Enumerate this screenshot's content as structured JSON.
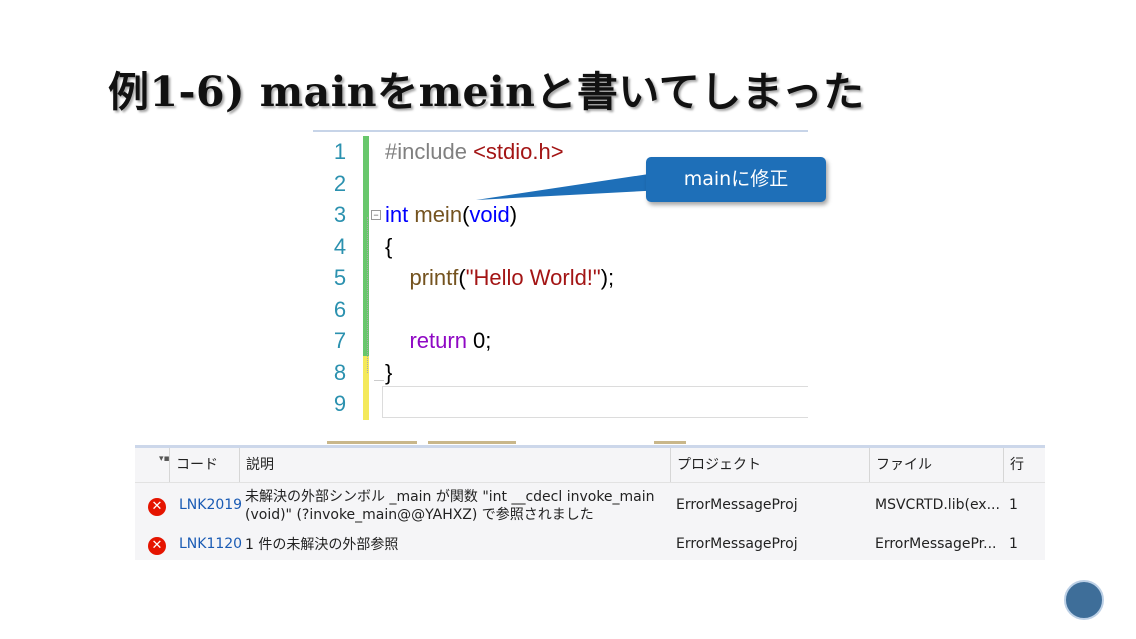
{
  "slide": {
    "title": "例1-6) mainをmeinと書いてしまった"
  },
  "editor": {
    "line_numbers": [
      "1",
      "2",
      "3",
      "4",
      "5",
      "6",
      "7",
      "8",
      "9"
    ],
    "lines": [
      {
        "segments": [
          {
            "t": "#include ",
            "c": "pre"
          },
          {
            "t": "<stdio.h>",
            "c": "str"
          }
        ]
      },
      {
        "segments": []
      },
      {
        "segments": [
          {
            "t": "int",
            "c": "kw"
          },
          {
            "t": " ",
            "c": ""
          },
          {
            "t": "mein",
            "c": "fn"
          },
          {
            "t": "(",
            "c": ""
          },
          {
            "t": "void",
            "c": "kw"
          },
          {
            "t": ")",
            "c": ""
          }
        ]
      },
      {
        "segments": [
          {
            "t": "{",
            "c": ""
          }
        ]
      },
      {
        "segments": [
          {
            "t": "    ",
            "c": ""
          },
          {
            "t": "printf",
            "c": "fn"
          },
          {
            "t": "(",
            "c": ""
          },
          {
            "t": "\"Hello World!\"",
            "c": "str"
          },
          {
            "t": ");",
            "c": ""
          }
        ]
      },
      {
        "segments": []
      },
      {
        "segments": [
          {
            "t": "    ",
            "c": ""
          },
          {
            "t": "return",
            "c": "ctl"
          },
          {
            "t": " 0;",
            "c": ""
          }
        ]
      },
      {
        "segments": [
          {
            "t": "}",
            "c": ""
          }
        ]
      },
      {
        "segments": []
      }
    ]
  },
  "callout": {
    "text": "mainに修正"
  },
  "error_list": {
    "headers": {
      "code": "コード",
      "description": "説明",
      "project": "プロジェクト",
      "file": "ファイル",
      "line": "行"
    },
    "rows": [
      {
        "code": "LNK2019",
        "description": "未解決の外部シンボル _main が関数 \"int __cdecl invoke_main (void)\" (?invoke_main@@YAHXZ) で参照されました",
        "project": "ErrorMessageProj",
        "file": "MSVCRTD.lib(ex...",
        "line": "1"
      },
      {
        "code": "LNK1120",
        "description": "1 件の未解決の外部参照",
        "project": "ErrorMessageProj",
        "file": "ErrorMessagePr...",
        "line": "1"
      }
    ]
  },
  "icons": {
    "error": "error-circle-icon",
    "filter": "filter-icon",
    "collapse": "collapse-minus-icon",
    "logo": "logo-icon"
  },
  "colors": {
    "accent": "#1e6fb8",
    "error": "#e51400",
    "link": "#1a5bb4",
    "changed_green": "#68c76c",
    "changed_yellow": "#f4e95a"
  }
}
